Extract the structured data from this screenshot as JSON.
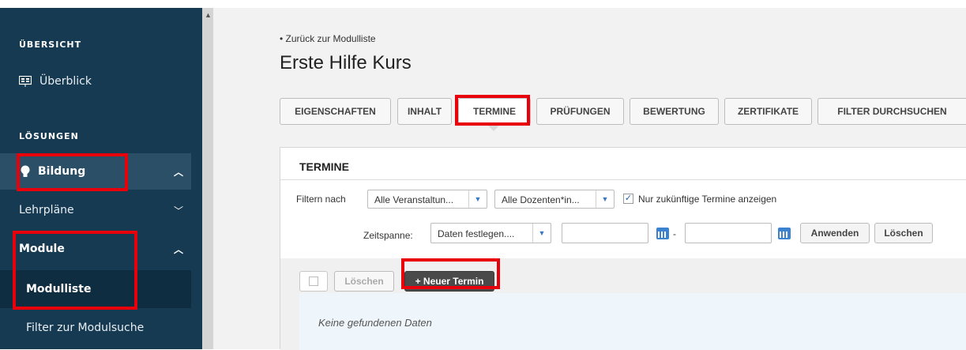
{
  "sidebar": {
    "overview_header": "ÜBERSICHT",
    "overview_item": "Überblick",
    "solutions_header": "LÖSUNGEN",
    "bildung": "Bildung",
    "lehrplaene": "Lehrpläne",
    "module": "Module",
    "modulliste": "Modulliste",
    "filter_modulsuche": "Filter zur Modulsuche",
    "icons": {
      "overview": "presentation-icon",
      "bildung": "lightbulb-icon"
    }
  },
  "page": {
    "back_link": "• Zurück zur Modulliste",
    "title": "Erste Hilfe Kurs"
  },
  "tabs": [
    {
      "label": "EIGENSCHAFTEN"
    },
    {
      "label": "INHALT"
    },
    {
      "label": "TERMINE",
      "active": true
    },
    {
      "label": "PRÜFUNGEN"
    },
    {
      "label": "BEWERTUNG"
    },
    {
      "label": "ZERTIFIKATE"
    },
    {
      "label": "FILTER DURCHSUCHEN"
    }
  ],
  "panel": {
    "title": "TERMINE",
    "filter_label": "Filtern nach",
    "events_select": "Alle Veranstaltun...",
    "lecturers_select": "Alle Dozenten*in...",
    "future_only_label": "Nur zukünftige Termine anzeigen",
    "future_only_checked": true,
    "period_label": "Zeitspanne:",
    "period_select": "Daten festlegen....",
    "date_separator": "-",
    "apply_button": "Anwenden",
    "clear_button": "Löschen"
  },
  "list": {
    "delete_button": "Löschen",
    "new_button": "+ Neuer Termin",
    "empty_text": "Keine gefundenen Daten"
  },
  "colors": {
    "sidebar_bg": "#163a52",
    "sidebar_selected_bg": "#2a4f66",
    "highlight": "#e8000b",
    "new_button_bg": "#4a4a4a"
  }
}
